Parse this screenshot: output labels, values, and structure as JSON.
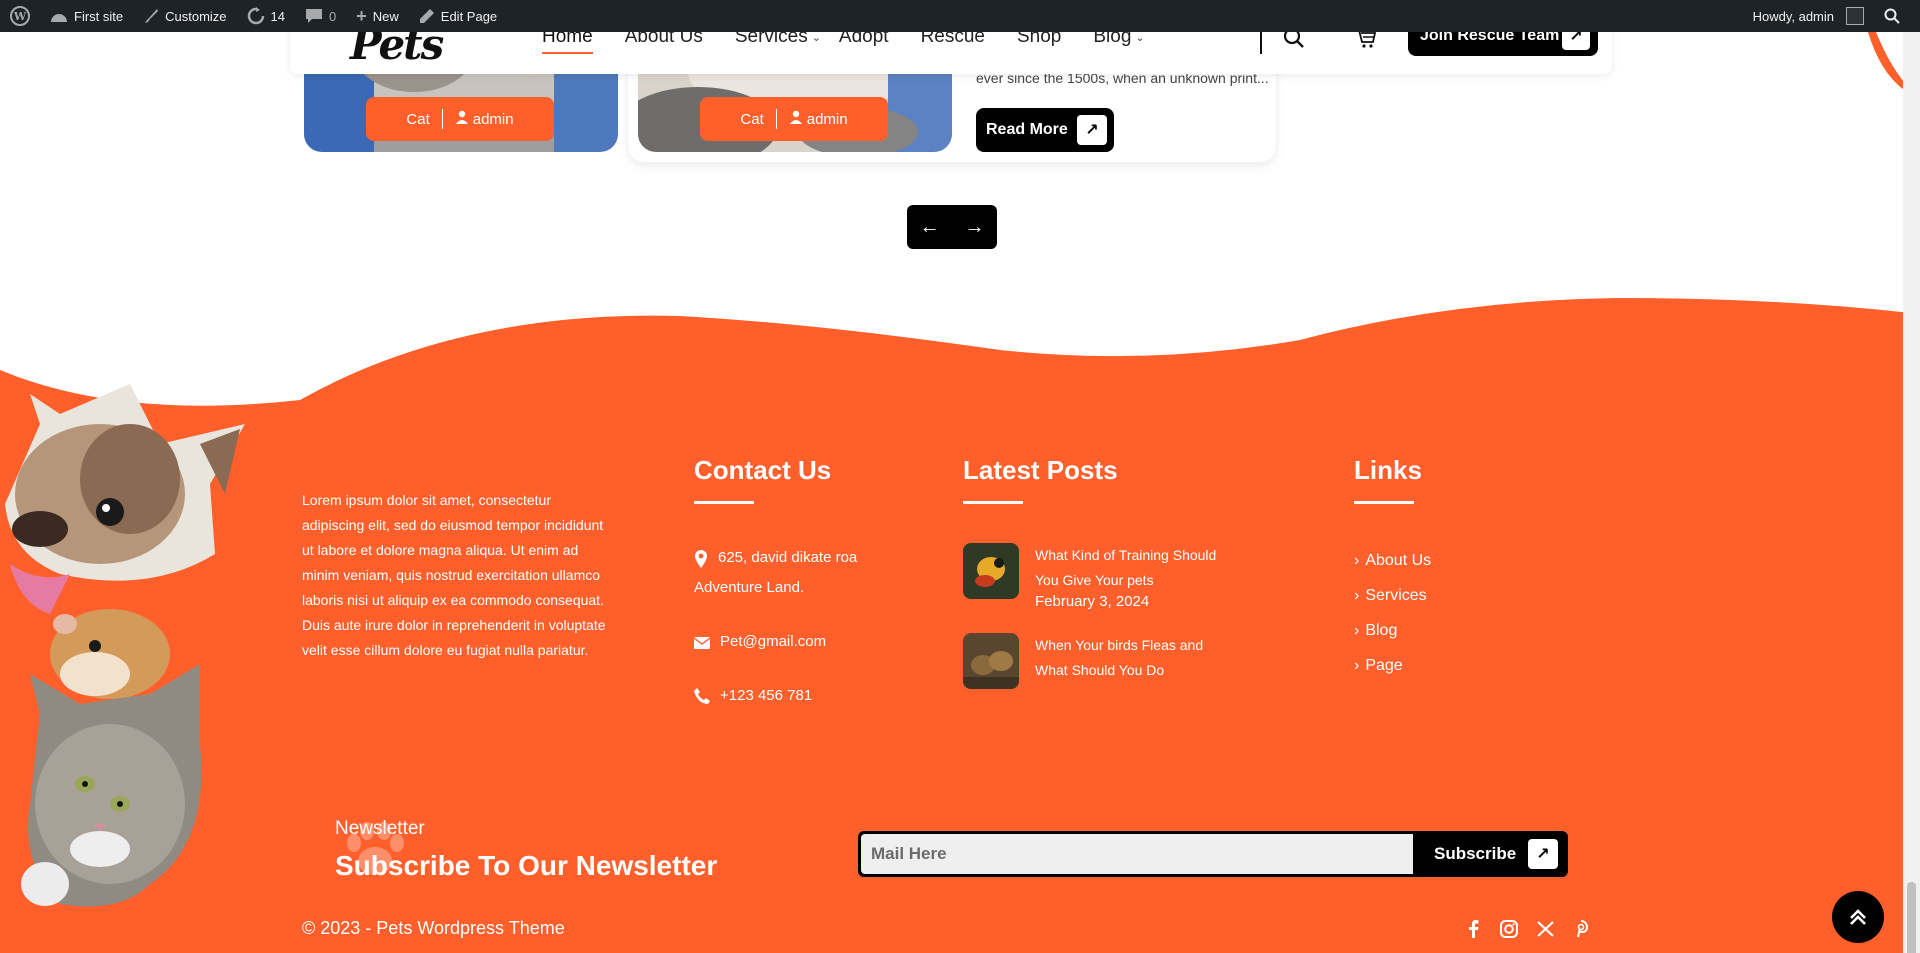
{
  "admin_bar": {
    "site_name": "First site",
    "customize": "Customize",
    "updates_count": "14",
    "comments_count": "0",
    "new_label": "New",
    "edit_page": "Edit Page",
    "greeting": "Howdy, admin"
  },
  "header": {
    "logo": "Pets",
    "nav": [
      {
        "label": "Home"
      },
      {
        "label": "About Us"
      },
      {
        "label": "Services"
      },
      {
        "label": "Adopt"
      },
      {
        "label": "Rescue"
      },
      {
        "label": "Shop"
      },
      {
        "label": "Blog"
      }
    ],
    "cta_label": "Join Rescue Team"
  },
  "blog_cards": [
    {
      "category": "Cat",
      "author": "admin"
    },
    {
      "category": "Cat",
      "author": "admin",
      "excerpt": "ever since the 1500s, when an unknown print...",
      "read_more": "Read More"
    }
  ],
  "footer": {
    "about_text": "Lorem ipsum dolor sit amet, consectetur adipiscing elit, sed do eiusmod tempor incididunt ut labore et dolore magna aliqua. Ut enim ad minim veniam, quis nostrud exercitation ullamco laboris nisi ut aliquip ex ea commodo consequat. Duis aute irure dolor in reprehenderit in voluptate velit esse cillum dolore eu fugiat nulla pariatur.",
    "contact": {
      "title": "Contact Us",
      "address_line1": "625, david dikate roa",
      "address_line2": "Adventure Land.",
      "email": "Pet@gmail.com",
      "phone": "+123 456 781"
    },
    "latest_posts": {
      "title": "Latest Posts",
      "items": [
        {
          "title": "What Kind of Training Should You Give Your pets",
          "date": "February 3, 2024"
        },
        {
          "title": "When Your birds Fleas and What Should You Do"
        }
      ]
    },
    "links": {
      "title": "Links",
      "items": [
        {
          "label": "About Us"
        },
        {
          "label": "Services"
        },
        {
          "label": "Blog"
        },
        {
          "label": "Page"
        }
      ]
    },
    "newsletter": {
      "label": "Newsletter",
      "title": "Subscribe To Our Newsletter",
      "placeholder": "Mail Here",
      "button": "Subscribe"
    },
    "copyright": "© 2023 - Pets Wordpress Theme"
  },
  "colors": {
    "accent": "#ff5f2b",
    "dark": "#000000",
    "admin_bar": "#1d2327"
  }
}
